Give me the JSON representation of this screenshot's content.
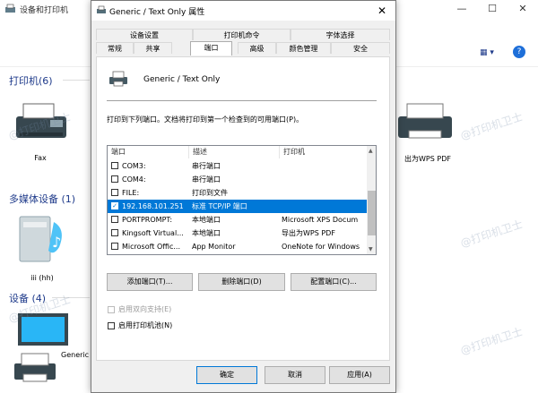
{
  "background_window": {
    "title": "设备和打印机",
    "sections": [
      {
        "title": "打印机(6)"
      },
      {
        "title": "多媒体设备 (1)"
      },
      {
        "title": "设备 (4)"
      }
    ],
    "devices": {
      "fax": "Fax",
      "wps_pdf": "出为WPS PDF",
      "media": "iii (hh)",
      "generic": "Generic"
    },
    "view_icon": "▦ ▾",
    "help_icon": "?"
  },
  "watermark": "@打印机卫士",
  "dialog": {
    "title": "Generic / Text Only 属性",
    "close": "✕",
    "tabs_row1": [
      "设备设置",
      "打印机命令",
      "字体选择"
    ],
    "tabs_row2": [
      "常规",
      "共享",
      "端口",
      "高级",
      "颜色管理",
      "安全"
    ],
    "active_tab": "端口",
    "printer_name": "Generic / Text Only",
    "instruction": "打印到下列端口。文档将打印到第一个检查到的可用端口(P)。",
    "columns": [
      "端口",
      "描述",
      "打印机"
    ],
    "ports": [
      {
        "checked": false,
        "port": "COM3:",
        "desc": "串行端口",
        "printer": "",
        "selected": false
      },
      {
        "checked": false,
        "port": "COM4:",
        "desc": "串行端口",
        "printer": "",
        "selected": false
      },
      {
        "checked": false,
        "port": "FILE:",
        "desc": "打印到文件",
        "printer": "",
        "selected": false
      },
      {
        "checked": true,
        "port": "192.168.101.251",
        "desc": "标准 TCP/IP 端口",
        "printer": "",
        "selected": true
      },
      {
        "checked": false,
        "port": "PORTPROMPT:",
        "desc": "本地端口",
        "printer": "Microsoft XPS Docum",
        "selected": false
      },
      {
        "checked": false,
        "port": "Kingsoft Virtual...",
        "desc": "本地端口",
        "printer": "导出为WPS PDF",
        "selected": false
      },
      {
        "checked": false,
        "port": "Microsoft Offic...",
        "desc": "App Monitor",
        "printer": "OneNote for Windows",
        "selected": false
      }
    ],
    "buttons": {
      "add_port": "添加端口(T)...",
      "delete_port": "删除端口(D)",
      "config_port": "配置端口(C)...",
      "ok": "确定",
      "cancel": "取消",
      "apply": "应用(A)"
    },
    "bidirectional": "启用双向支持(E)",
    "pooling": "启用打印机池(N)"
  }
}
